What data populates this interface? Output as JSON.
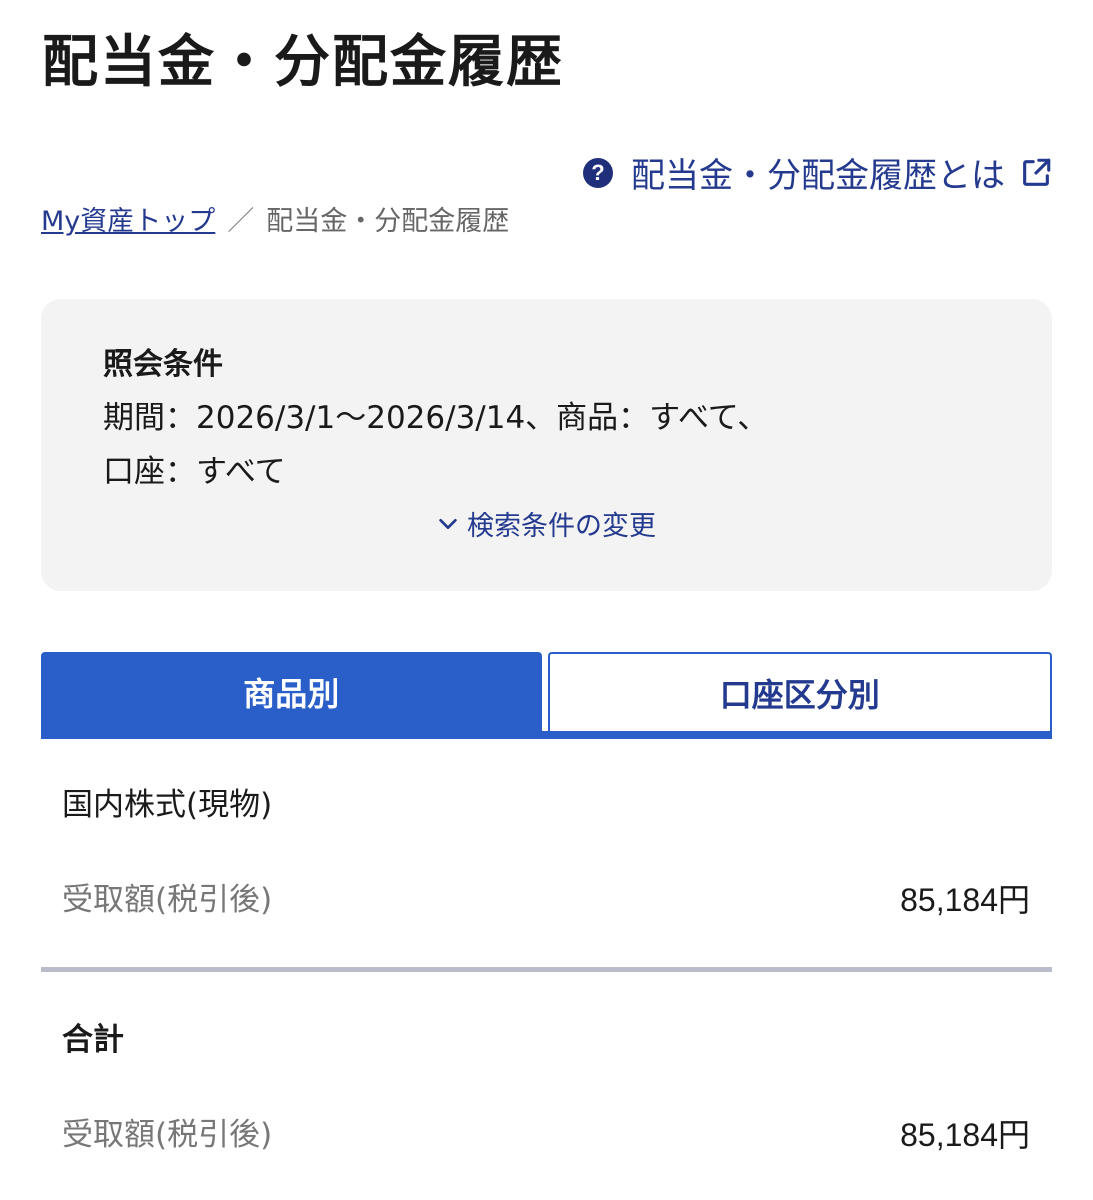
{
  "header": {
    "title": "配当金・分配金履歴",
    "help_link": "配当金・分配金履歴とは",
    "help_icon": "question-circle-icon",
    "external_icon": "external-link-icon"
  },
  "breadcrumb": {
    "home": "My資産トップ",
    "separator": "／",
    "current": "配当金・分配金履歴"
  },
  "conditions": {
    "title": "照会条件",
    "line1": "期間：2026/3/1〜2026/3/14、商品：すべて、",
    "line2": "口座：すべて",
    "change_label": "検索条件の変更",
    "change_icon": "chevron-down-icon"
  },
  "tabs": [
    {
      "label": "商品別",
      "active": true
    },
    {
      "label": "口座区分別",
      "active": false
    }
  ],
  "sections": [
    {
      "heading": "国内株式(現物)",
      "row_label": "受取額(税引後)",
      "row_value": "85,184円"
    },
    {
      "heading": "合計",
      "row_label": "受取額(税引後)",
      "row_value": "85,184円"
    }
  ],
  "colors": {
    "accent": "#2a5fc9",
    "link": "#243a8f",
    "panel_bg": "#f3f3f3"
  }
}
